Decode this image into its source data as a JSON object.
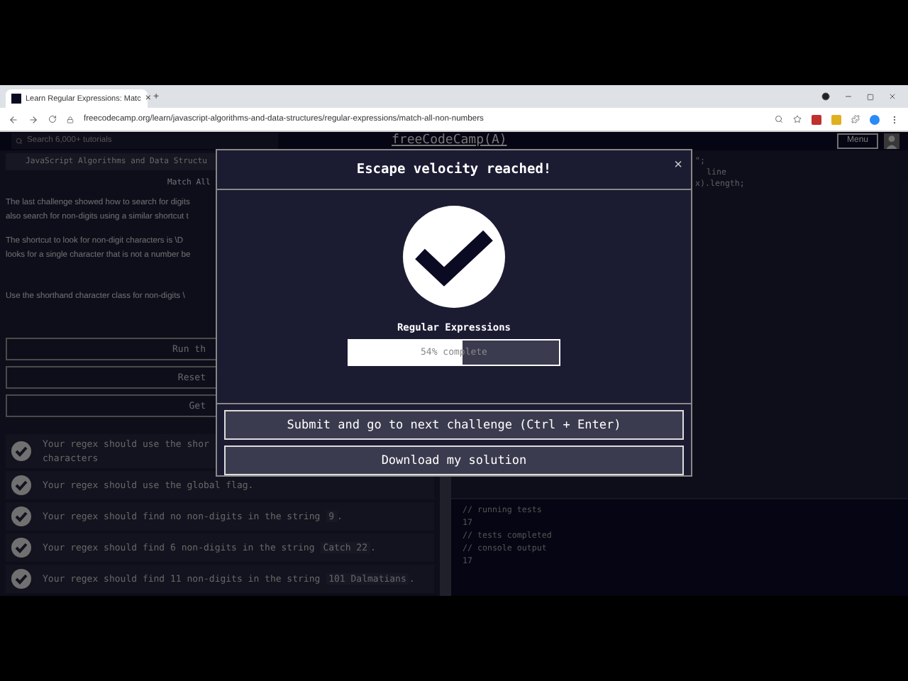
{
  "browser": {
    "tab": {
      "title": "Learn Regular Expressions: Matc",
      "close": "×"
    },
    "new_tab": "+",
    "url": "freecodecamp.org/learn/javascript-algorithms-and-data-structures/regular-expressions/match-all-non-numbers"
  },
  "nav": {
    "search": {
      "placeholder": "Search 6,000+ tutorials"
    },
    "brand": "freeCodeCamp(A)",
    "menu": "Menu"
  },
  "lesson": {
    "breadcrumb": "JavaScript Algorithms and Data Structu",
    "title": "Match All",
    "paragraphs": [
      {
        "lines": [
          "The last challenge showed how to search for digits",
          "also search for non-digits using a similar shortcut t"
        ]
      },
      {
        "lines": [
          "The shortcut to look for non-digit characters is \\D",
          "looks for a single character that is not a number be"
        ]
      },
      {
        "lines": [
          "Use the shorthand character class for non-digits \\"
        ]
      }
    ],
    "buttons": [
      "Run th",
      "Reset",
      "Get"
    ],
    "tests": [
      {
        "lines": [
          "Your regex should use the shor",
          "characters"
        ],
        "passed": true
      },
      {
        "lines": [
          "Your regex should use the global flag."
        ],
        "passed": true
      },
      {
        "lines": [
          "Your regex should find no non-digits in the string"
        ],
        "code": "9",
        "end": ".",
        "passed": true
      },
      {
        "lines": [
          "Your regex should find 6 non-digits in the string"
        ],
        "code": "Catch 22",
        "end": ".",
        "passed": true
      },
      {
        "lines": [
          "Your regex should find 11 non-digits in the string"
        ],
        "code": "101 Dalmatians",
        "end": ".",
        "passed": true
      }
    ]
  },
  "editor": {
    "lines": [
      "\";",
      "line",
      "x).length;"
    ]
  },
  "console": {
    "lines": [
      "// running tests",
      "17",
      "// tests completed",
      "// console output",
      "17"
    ]
  },
  "modal": {
    "title": "Escape velocity reached!",
    "close": "×",
    "block": "Regular Expressions",
    "progress": {
      "level": 0.54,
      "label": "54% complete"
    },
    "buttons": [
      "Submit and go to next challenge (Ctrl + Enter)",
      "Download my solution"
    ]
  }
}
